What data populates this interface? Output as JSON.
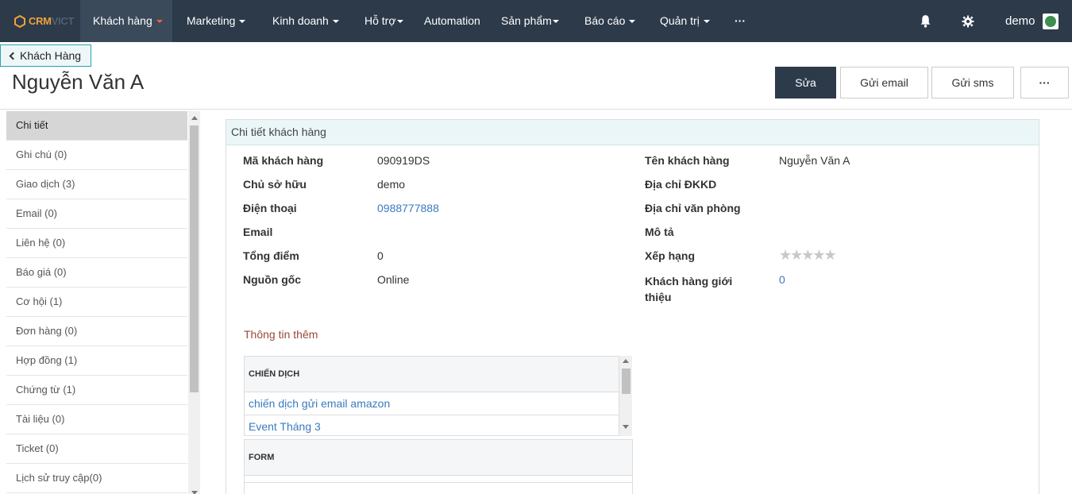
{
  "app": {
    "logo_a": "CRM",
    "logo_b": "VICT"
  },
  "nav": {
    "items": [
      {
        "label": "Khách hàng",
        "caret": true,
        "active": true
      },
      {
        "label": "Marketing",
        "caret": true
      },
      {
        "label": "Kinh doanh",
        "caret": true
      },
      {
        "label": "Hỗ trợ",
        "caret": true
      },
      {
        "label": "Automation",
        "caret": false
      },
      {
        "label": "Sản phẩm",
        "caret": true
      },
      {
        "label": "Báo cáo",
        "caret": true
      },
      {
        "label": "Quản trị",
        "caret": true
      },
      {
        "label": "···",
        "caret": false
      }
    ],
    "user": "demo",
    "bell_icon": "bell-icon",
    "gear_icon": "gear-icon"
  },
  "header": {
    "back_label": "Khách Hàng",
    "title": "Nguyễn Văn A",
    "actions": {
      "edit": "Sửa",
      "email": "Gửi email",
      "sms": "Gửi sms",
      "more": "···"
    }
  },
  "sidebar": {
    "items": [
      "Chi tiết",
      "Ghi chú (0)",
      "Giao dịch (3)",
      "Email (0)",
      "Liên hệ (0)",
      "Báo giá (0)",
      "Cơ hội (1)",
      "Đơn hàng (0)",
      "Hợp đồng (1)",
      "Chứng từ (1)",
      "Tài liệu (0)",
      "Ticket (0)",
      "Lịch sử truy cập(0)"
    ]
  },
  "details": {
    "heading": "Chi tiết khách hàng",
    "left": [
      {
        "label": "Mã khách hàng",
        "value": "090919DS"
      },
      {
        "label": "Chủ sở hữu",
        "value": "demo"
      },
      {
        "label": "Điện thoại",
        "value": "0988777888"
      },
      {
        "label": "Email",
        "value": ""
      },
      {
        "label": "Tổng điểm",
        "value": "0"
      },
      {
        "label": "Nguồn gốc",
        "value": "Online"
      }
    ],
    "right": [
      {
        "label": "Tên khách hàng",
        "value": "Nguyễn Văn A"
      },
      {
        "label": "Địa chỉ ĐKKD",
        "value": ""
      },
      {
        "label": "Địa chỉ văn phòng",
        "value": ""
      },
      {
        "label": "Mô tả",
        "value": ""
      },
      {
        "label": "Xếp hạng",
        "value": "★★★★★"
      },
      {
        "label": "Khách hàng giới thiệu",
        "value": "0"
      }
    ],
    "rating": 0
  },
  "extra": {
    "title": "Thông tin thêm",
    "campaign_header": "CHIẾN DỊCH",
    "campaigns": [
      "chiến dịch gửi email amazon",
      "Event Tháng 3"
    ],
    "form_header": "FORM"
  },
  "colors": {
    "nav_bg": "#2c3a4a",
    "accent": "#f0a23b",
    "link": "#3a7bbf"
  }
}
